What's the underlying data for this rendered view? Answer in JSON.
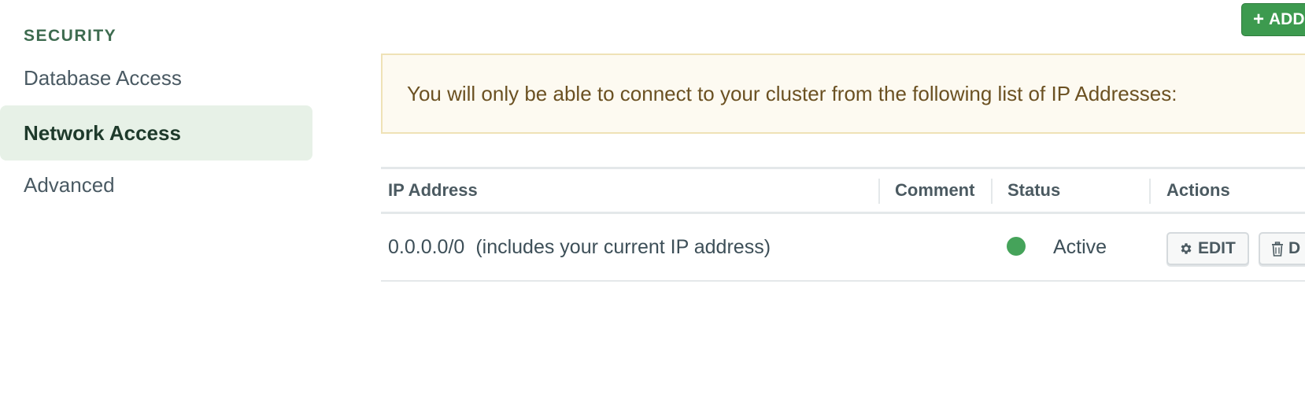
{
  "sidebar": {
    "heading": "SECURITY",
    "items": [
      {
        "label": "Database Access",
        "active": false
      },
      {
        "label": "Network Access",
        "active": true
      },
      {
        "label": "Advanced",
        "active": false
      }
    ]
  },
  "toolbar": {
    "add_label": "ADD"
  },
  "banner": {
    "text": "You will only be able to connect to your cluster from the following list of IP Addresses:"
  },
  "table": {
    "headers": [
      "IP Address",
      "Comment",
      "Status",
      "Actions"
    ],
    "rows": [
      {
        "ip": "0.0.0.0/0",
        "ip_note": "(includes your current IP address)",
        "comment": "",
        "status": "Active",
        "status_color": "#45a35a",
        "actions": {
          "edit_label": "EDIT",
          "delete_label": "D"
        }
      }
    ]
  },
  "colors": {
    "accent": "#3d9a4f",
    "active_nav_bg": "#e7f1e7",
    "banner_bg": "#fdfaf1",
    "banner_border": "#efe2b6"
  },
  "icons": {
    "add": "plus-icon",
    "edit": "gear-icon",
    "delete": "trash-icon"
  }
}
